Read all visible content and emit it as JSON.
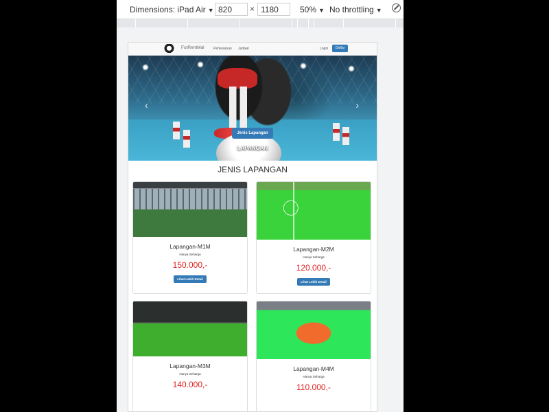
{
  "devtools": {
    "device_label": "Dimensions: iPad Air",
    "width_value": "820",
    "height_value": "1180",
    "times": "×",
    "zoom": "50%",
    "throttle": "No throttling"
  },
  "navbar": {
    "brand": "FutRentMal",
    "links": [
      "Pemesanan",
      "Jadwal"
    ],
    "login": "Login",
    "daftar": "Daftar"
  },
  "carousel": {
    "button": "Jenis Lapangan",
    "caption": "LAPANGAN",
    "prev": "‹",
    "next": "›"
  },
  "section": {
    "title": "JENIS LAPANGAN"
  },
  "cards": [
    {
      "title": "Lapangan-M1M",
      "sub": "Hanya Seharga",
      "price": "150.000,-",
      "button": "Lihat Lebih Detail"
    },
    {
      "title": "Lapangan-M2M",
      "sub": "Hanya Seharga",
      "price": "120.000,-",
      "button": "Lihat Lebih Detail"
    },
    {
      "title": "Lapangan-M3M",
      "sub": "Hanya Seharga",
      "price": "140.000,-"
    },
    {
      "title": "Lapangan-M4M",
      "sub": "Hanya Seharga",
      "price": "110.000,-"
    }
  ]
}
